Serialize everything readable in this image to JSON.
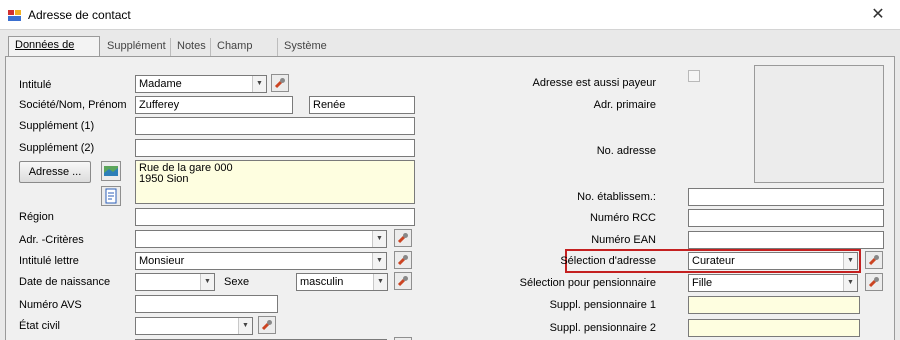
{
  "window": {
    "title": "Adresse de contact",
    "close_glyph": "✕"
  },
  "tabs": [
    {
      "label": "Données de base"
    },
    {
      "label": "Supplément"
    },
    {
      "label": "Notes"
    },
    {
      "label": "Champ libre"
    },
    {
      "label": "Système étranger"
    }
  ],
  "form": {
    "intitule": {
      "label": "Intitulé",
      "value": "Madame"
    },
    "societe": {
      "label": "Société/Nom, Prénom",
      "nom": "Zufferey",
      "prenom": "Renée"
    },
    "supplement1": {
      "label": "Supplément (1)",
      "value": ""
    },
    "supplement2": {
      "label": "Supplément (2)",
      "value": ""
    },
    "adresse_button": "Adresse ...",
    "adresse": {
      "line1": "Rue de la gare 000",
      "line2": "1950 Sion"
    },
    "region": {
      "label": "Région",
      "value": ""
    },
    "adr_criteres": {
      "label": "Adr. -Critères",
      "value": ""
    },
    "intitule_lettre": {
      "label": "Intitulé lettre",
      "value": "Monsieur"
    },
    "date_naissance": {
      "label": "Date de naissance",
      "value": ""
    },
    "sexe": {
      "label": "Sexe",
      "value": "masculin"
    },
    "numero_avs": {
      "label": "Numéro  AVS",
      "value": ""
    },
    "etat_civil": {
      "label": "État civil",
      "value": ""
    }
  },
  "right": {
    "aussi_payeur": {
      "label": "Adresse est aussi payeur",
      "checked": false
    },
    "adr_primaire": {
      "label": "Adr. primaire"
    },
    "no_adresse": {
      "label": "No. adresse"
    },
    "no_etablissem": {
      "label": "No. établissem.:",
      "value": ""
    },
    "numero_rcc": {
      "label": "Numéro RCC",
      "value": ""
    },
    "numero_ean": {
      "label": "Numéro EAN",
      "value": ""
    },
    "selection_adresse": {
      "label": "Sélection d'adresse",
      "value": "Curateur"
    },
    "selection_pensionnaire": {
      "label": "Sélection pour pensionnaire",
      "value": "Fille"
    },
    "suppl_pens1": {
      "label": "Suppl. pensionnaire 1",
      "value": ""
    },
    "suppl_pens2": {
      "label": "Suppl. pensionnaire 2",
      "value": ""
    }
  },
  "colors": {
    "highlight": "#c42020",
    "yellow_field": "#fefee0"
  },
  "icons": [
    "app-icon",
    "close-icon",
    "wrench-icon",
    "map-icon",
    "document-icon",
    "dropdown-arrow-icon"
  ]
}
